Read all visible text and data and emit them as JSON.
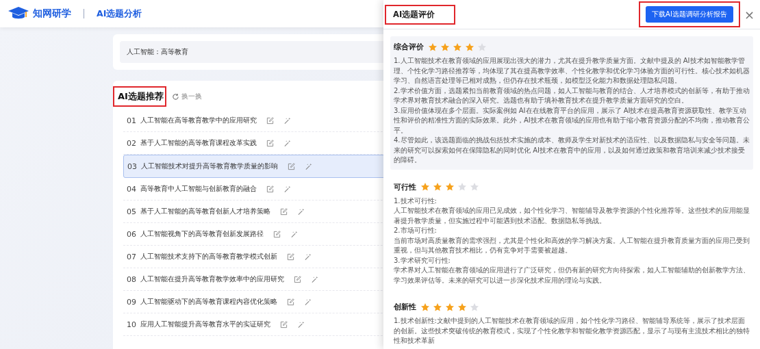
{
  "header": {
    "brand": "知网研学",
    "page_title": "AI选题分析"
  },
  "query": {
    "value": "人工智能：高等教育"
  },
  "recommend": {
    "heading": {
      "text": "AI选题推荐",
      "highlighted": true
    },
    "refresh": "换一换"
  },
  "topics": [
    {
      "number": "01",
      "title": "人工智能在高等教育教学中的应用研究",
      "selected": false
    },
    {
      "number": "02",
      "title": "基于人工智能的高等教育课程改革实践",
      "selected": false
    },
    {
      "number": "03",
      "title": "人工智能技术对提升高等教育教学质量的影响",
      "selected": true
    },
    {
      "number": "04",
      "title": "高等教育中人工智能与创新教育的融合",
      "selected": false
    },
    {
      "number": "05",
      "title": "基于人工智能的高等教育创新人才培养策略",
      "selected": false
    },
    {
      "number": "06",
      "title": "人工智能视角下的高等教育创新发展路径",
      "selected": false
    },
    {
      "number": "07",
      "title": "人工智能技术支持下的高等教育教学模式创新",
      "selected": false
    },
    {
      "number": "08",
      "title": "人工智能在提升高等教育教学效率中的应用研究",
      "selected": false
    },
    {
      "number": "09",
      "title": "人工智能驱动下的高等教育课程内容优化策略",
      "selected": false
    },
    {
      "number": "10",
      "title": "应用人工智能提升高等教育水平的实证研究",
      "selected": false
    }
  ],
  "drawer": {
    "title": {
      "text": "AI选题评价",
      "highlighted": true
    },
    "download_button": {
      "label": "下载AI选题调研分析报告",
      "highlighted": true
    },
    "close": "×"
  },
  "sections": [
    {
      "title": "综合评价",
      "stars": 4,
      "kind": "summary",
      "paragraphs": [
        "1.人工智能技术在教育领域的应用展现出强大的潜力，尤其在提升教学质量方面。文献中提及的 AI技术如智能教学管理、个性化学习路径推荐等，均体现了其在提高教学效率、个性化教学和优化学习体验方面的可行性。核心技术如机器学习、自然语言处理等已相对成熟，但仍存在技术瓶颈，如模型泛化能力和数据处理隐私问题。",
        "2.学术价值方面，选题紧扣当前教育领域的热点问题，如人工智能与教育的结合、人才培养模式的创新等，有助于推动学术界对教育技术融合的深入研究。选题也有助于填补教育技术在提升教学质量方面研究的空白。",
        "3.应用价值体现在多个层面。实际案例如 AI在在线教育平台的应用，展示了 AI技术在提高教育资源获取性、教学互动性和评价的精准性方面的实际效果。此外，AI技术在教育领域的应用也有助于缩小教育资源分配的不均衡，推动教育公平。",
        "4.尽管如此，该选题面临的挑战包括技术实施的成本、教师及学生对新技术的适应性、以及数据隐私与安全等问题。未来的研究可以探索如何在保障隐私的同时优化 AI技术在教育中的应用，以及如何通过政策和教育培训来减少技术接受的障碍。"
      ]
    },
    {
      "title": "可行性",
      "stars": 3,
      "kind": "criterion",
      "paragraphs": [
        "1.技术可行性:",
        "人工智能技术在教育领域的应用已见成效，如个性化学习、智能辅导及教学资源的个性化推荐等。这些技术的应用能显著提升教学质量，但实施过程中可能遇到技术适配、数据隐私等挑战。",
        "2.市场可行性:",
        "当前市场对高质量教育的需求强烈，尤其是个性化和高效的学习解决方案。人工智能在提升教育质量方面的应用已受到重视，但与其他教育技术相比，仍有竞争对手需要被超越。",
        "3.学术研究可行性:",
        "学术界对人工智能在教育领域的应用进行了广泛研究，但仍有新的研究方向待探索，如人工智能辅助的创新教学方法、学习效果评估等。未来的研究可以进一步深化技术应用的理论与实践。"
      ]
    },
    {
      "title": "创新性",
      "stars": 4,
      "kind": "criterion",
      "paragraphs": [
        "1.技术创新性:文献中提到的人工智能技术在教育领域的应用，如个性化学习路径、智能辅导系统等，展示了技术层面的创新。这些技术突破传统的教育模式，实现了个性化教学和智能化教学资源匹配，显示了与现有主流技术相比的独特性和技术革新"
      ]
    }
  ]
}
